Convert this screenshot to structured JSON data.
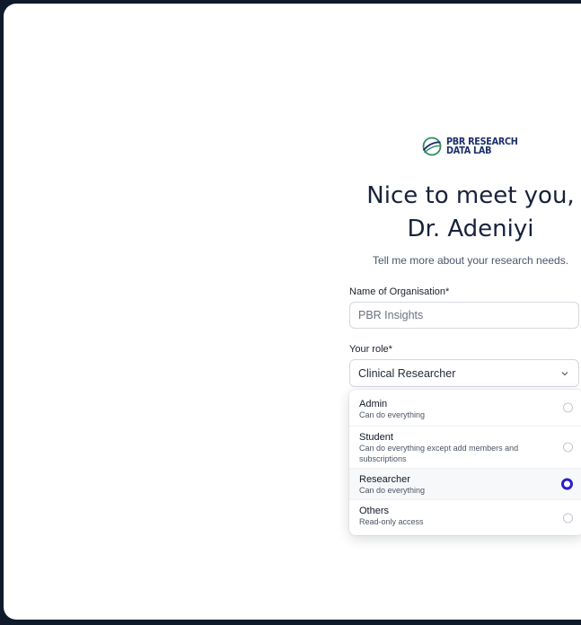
{
  "brand": {
    "line1": "PBR RESEARCH",
    "line2": "DATA LAB",
    "icon": "planet-ring-icon",
    "color": "#1b2f6a",
    "accent": "#2f8a5f"
  },
  "heading": {
    "title": "Nice to meet you, Dr. Adeniyi",
    "subtitle": "Tell me more about your research needs."
  },
  "form": {
    "organisation": {
      "label": "Name of Organisation*",
      "placeholder": "PBR Insights",
      "value": ""
    },
    "role": {
      "label": "Your role*",
      "value": "Clinical Researcher",
      "icon": "chevron-down-icon"
    }
  },
  "role_options": [
    {
      "title": "Admin",
      "description": "Can do everything",
      "selected": false
    },
    {
      "title": "Student",
      "description": "Can do everything except add members and subscriptions",
      "selected": false
    },
    {
      "title": "Researcher",
      "description": "Can do everything",
      "selected": true
    },
    {
      "title": "Others",
      "description": "Read-only access",
      "selected": false
    }
  ],
  "colors": {
    "background": "#0f1b2a",
    "radio_selected": "#2c1fc9",
    "text": "#17223b"
  }
}
